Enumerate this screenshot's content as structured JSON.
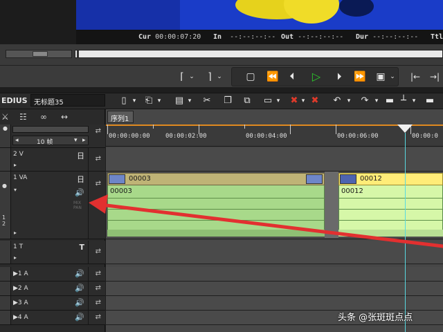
{
  "player": {
    "timecodes": [
      {
        "label": "Cur",
        "value": "00:00:07:20"
      },
      {
        "label": "In",
        "value": "--:--:--:--"
      },
      {
        "label": "Out",
        "value": "--:--:--:--"
      },
      {
        "label": "Dur",
        "value": "--:--:--:--"
      },
      {
        "label": "Ttl",
        "value": ""
      }
    ]
  },
  "toolbar": {
    "app_name": "EDIUS",
    "project_name": "无标题35"
  },
  "timeline": {
    "sequence_tab": "序列1",
    "zoom": "10 帧",
    "ruler_labels": [
      "00:00:00:00",
      "00:00:02:00",
      "00:00:04:00",
      "00:00:06:00",
      "00:00:0"
    ],
    "tracks": [
      {
        "id": "2v",
        "label": "2 V",
        "type_icon": "日"
      },
      {
        "id": "1va",
        "label": "1 VA",
        "type_icon": "日"
      },
      {
        "id": "1t",
        "label": "1 T",
        "type_icon": "T"
      },
      {
        "id": "a1",
        "label": "▶1 A"
      },
      {
        "id": "a2",
        "label": "▶2 A"
      },
      {
        "id": "a3",
        "label": "▶3 A"
      },
      {
        "id": "a4",
        "label": "▶4 A"
      }
    ],
    "clips": [
      {
        "name": "00003",
        "body_label": "00003",
        "selected": false
      },
      {
        "name": "00012",
        "body_label": "00012",
        "selected": true
      }
    ],
    "hidden_label": "MIX PAN"
  },
  "side_number": "1\n2",
  "watermark": "头条 @张斑斑点点",
  "colors": {
    "preview_blue": "#1a3cc8",
    "play_green": "#2cc82c",
    "clip_green": "#a8d98a",
    "clip_selected": "#d6f7a8",
    "playhead": "#58d8e0",
    "arrow_red": "#e23030"
  }
}
